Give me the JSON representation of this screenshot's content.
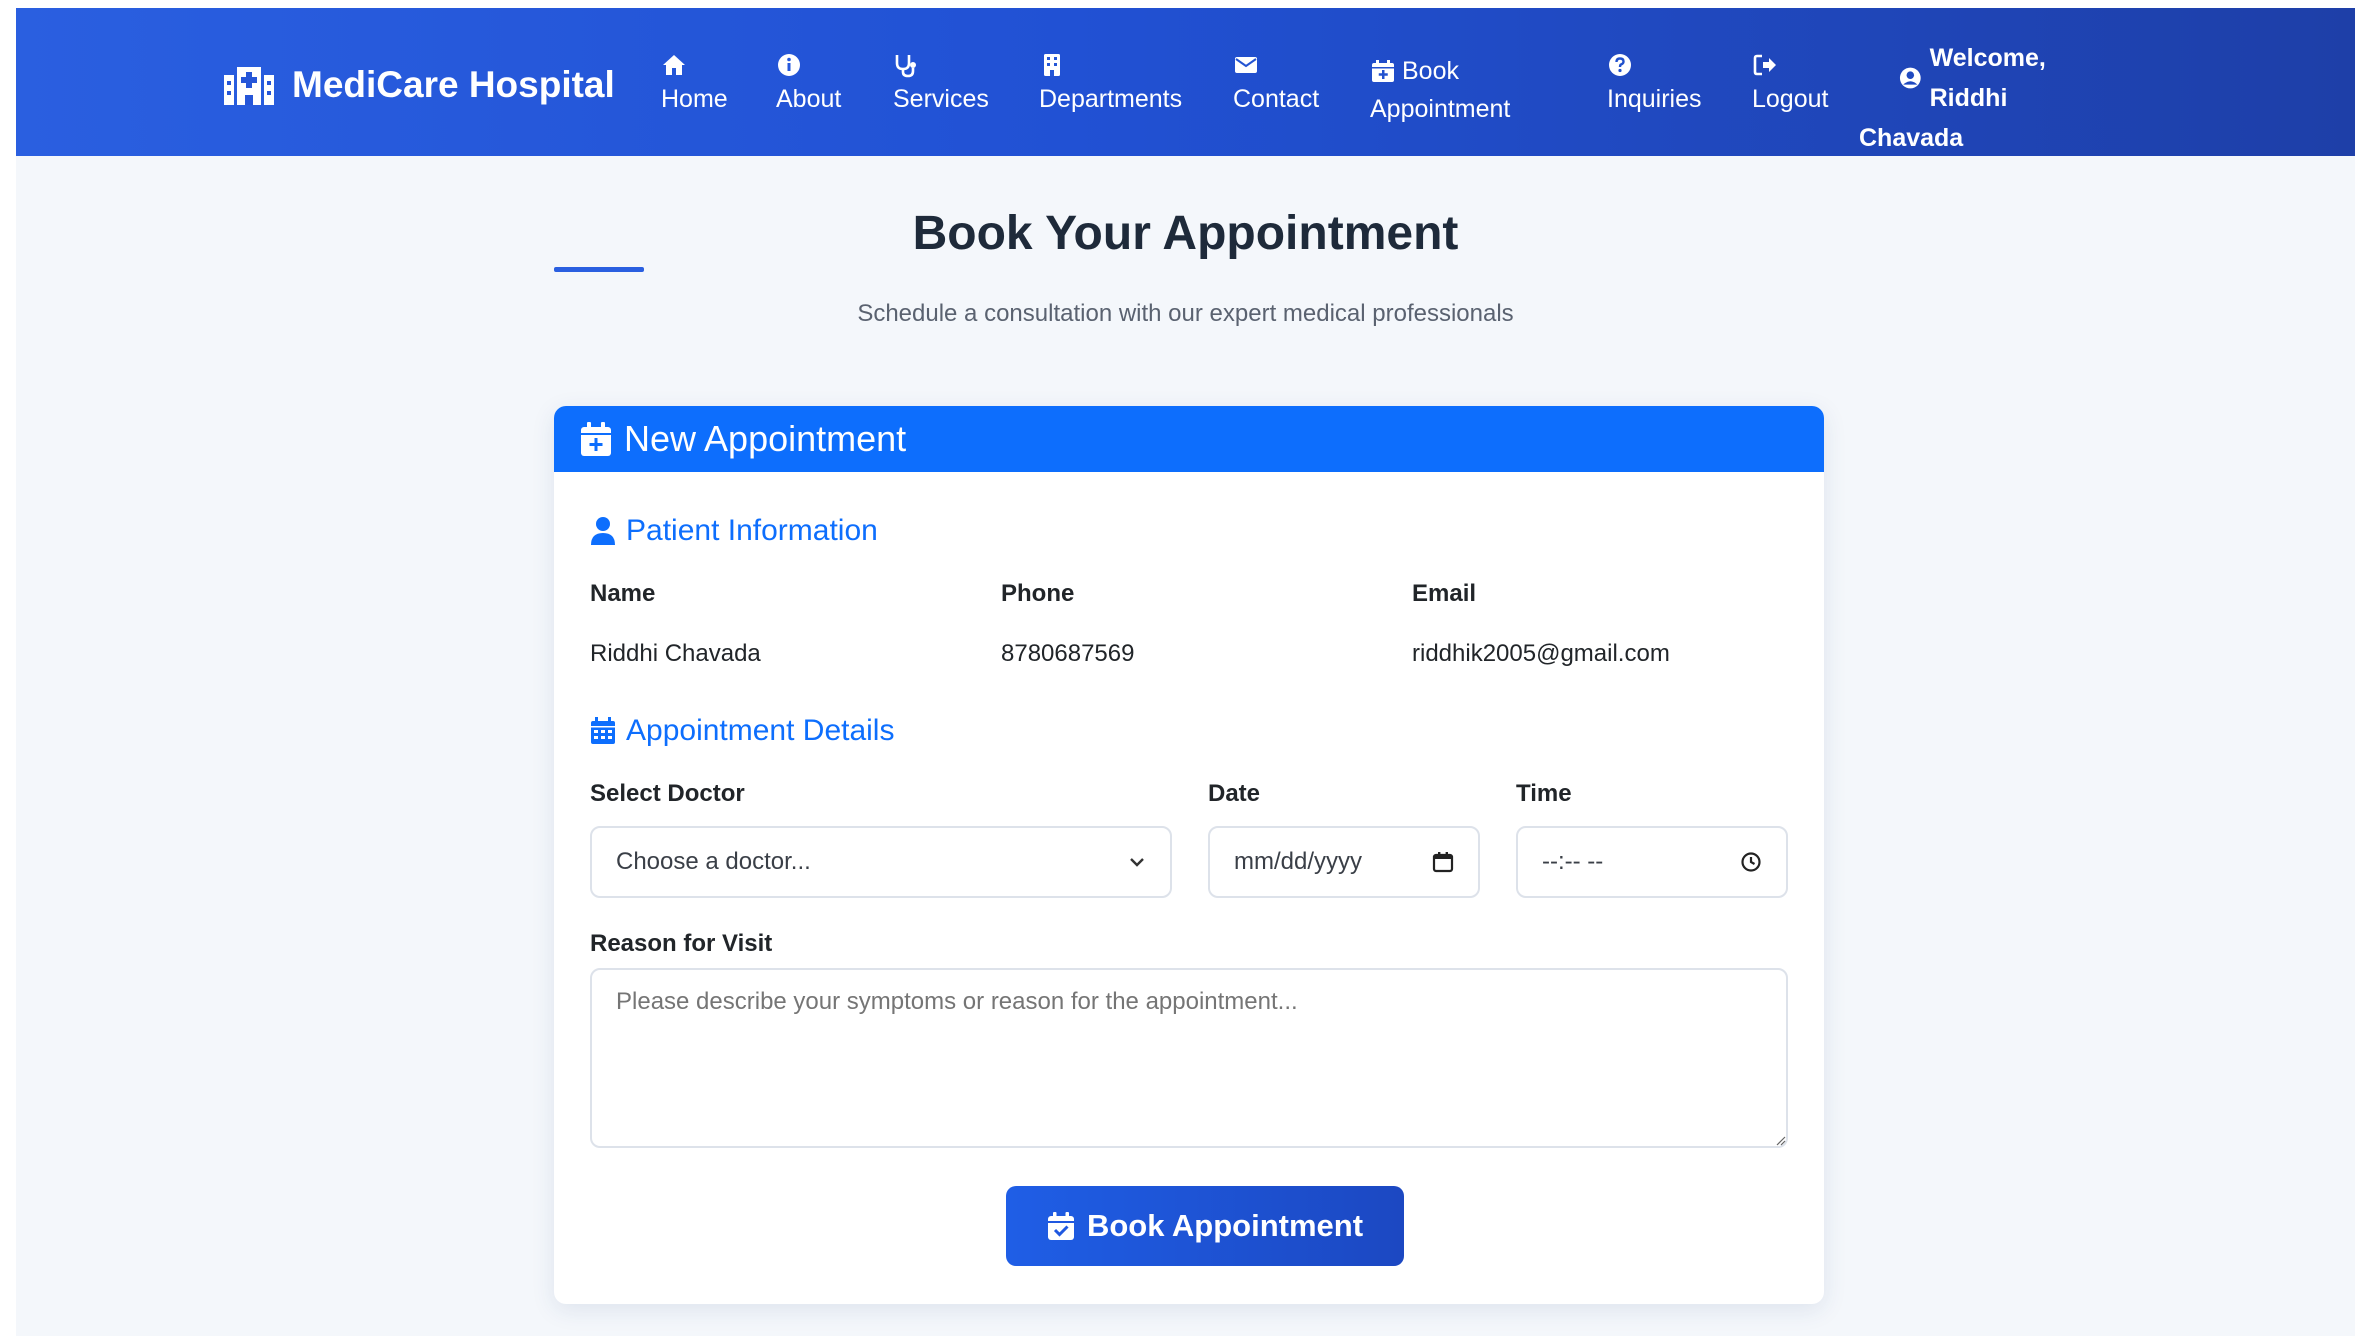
{
  "navbar": {
    "brand": "MediCare Hospital",
    "brand_icon": "hospital-icon",
    "items": [
      {
        "label": "Home",
        "icon": "home-icon"
      },
      {
        "label": "About",
        "icon": "info-icon"
      },
      {
        "label": "Services",
        "icon": "stethoscope-icon"
      },
      {
        "label": "Departments",
        "icon": "building-icon"
      },
      {
        "label": "Contact",
        "icon": "envelope-icon"
      },
      {
        "label_line1": "Book",
        "label_line2": "Appointment",
        "icon": "calendar-plus-icon"
      },
      {
        "label": "Inquiries",
        "icon": "question-circle-icon"
      },
      {
        "label": "Logout",
        "icon": "sign-out-icon"
      }
    ],
    "welcome_line1": "Welcome, Riddhi",
    "welcome_line2": "Chavada",
    "welcome_icon": "user-circle-icon"
  },
  "page": {
    "title": "Book Your Appointment",
    "subtitle": "Schedule a consultation with our expert medical professionals"
  },
  "card": {
    "header": "New Appointment",
    "patient_section": {
      "title": "Patient Information",
      "name_label": "Name",
      "name_value": "Riddhi Chavada",
      "phone_label": "Phone",
      "phone_value": "8780687569",
      "email_label": "Email",
      "email_value": "riddhik2005@gmail.com"
    },
    "appointment_section": {
      "title": "Appointment Details",
      "doctor_label": "Select Doctor",
      "doctor_value": "Choose a doctor...",
      "date_label": "Date",
      "date_value": "mm/dd/yyyy",
      "time_label": "Time",
      "time_value": "--:-- --",
      "reason_label": "Reason for Visit",
      "reason_placeholder": "Please describe your symptoms or reason for the appointment..."
    },
    "submit_label": "Book Appointment"
  },
  "colors": {
    "navbar_start": "#2a5fe0",
    "navbar_end": "#1e3fa8",
    "primary": "#0d6efd",
    "background": "#f4f7fb"
  }
}
